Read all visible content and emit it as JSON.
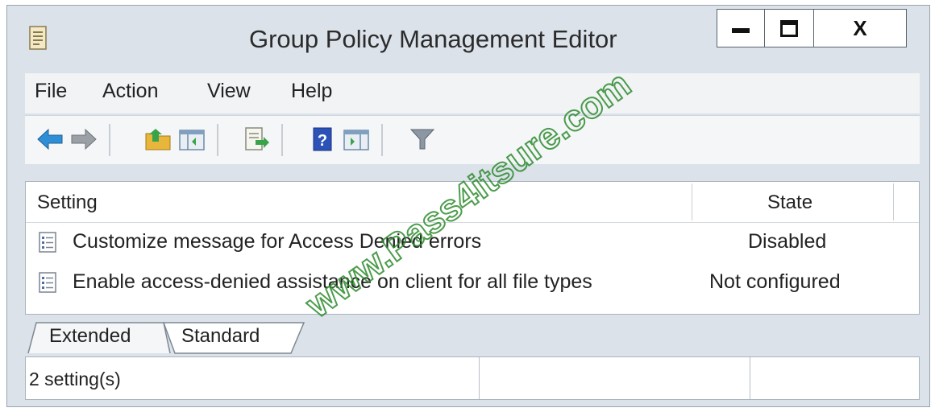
{
  "window": {
    "title": "Group Policy Management Editor",
    "close_label": "X"
  },
  "menu": {
    "items": [
      "File",
      "Action",
      "View",
      "Help"
    ]
  },
  "toolbar": {
    "buttons": [
      "back-arrow-icon",
      "forward-arrow-icon",
      "up-folder-icon",
      "show-hide-console-tree-icon",
      "export-list-icon",
      "help-icon",
      "show-hide-action-pane-icon",
      "filter-icon"
    ]
  },
  "list": {
    "columns": {
      "setting": "Setting",
      "state": "State"
    },
    "rows": [
      {
        "setting": "Customize message for Access Denied errors",
        "state": "Disabled"
      },
      {
        "setting": "Enable access-denied assistance on client for all file types",
        "state": "Not configured"
      }
    ]
  },
  "tabs": [
    "Extended",
    "Standard"
  ],
  "status": {
    "text": "2 setting(s)"
  },
  "watermark": {
    "text": "www.Pass4itsure.com"
  },
  "colors": {
    "watermark": "#2e8b2e",
    "window_frame": "#dbe2ea"
  }
}
